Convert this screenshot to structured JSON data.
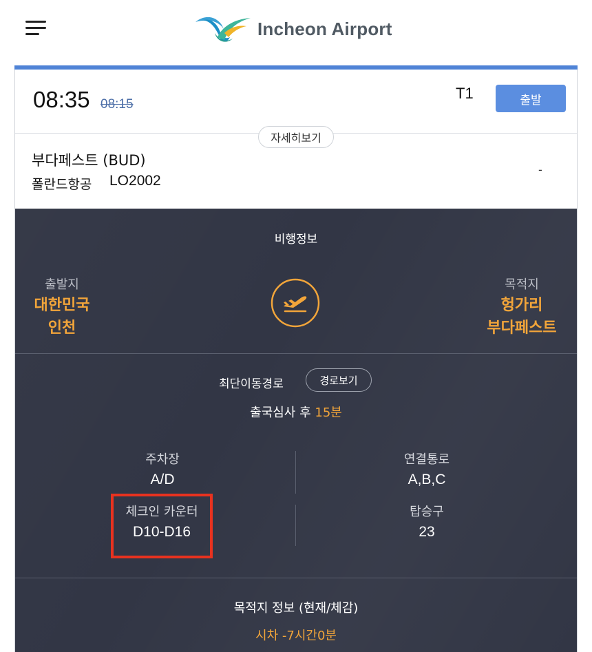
{
  "header": {
    "menu_icon": "hamburger-menu-icon",
    "logo_text": "Incheon Airport",
    "logo_icon": "incheon-airport-logo-icon"
  },
  "flight": {
    "time": "08:35",
    "scheduled_time": "08:15",
    "terminal": "T1",
    "status_label": "출발",
    "detail_button_label": "자세히보기",
    "destination": "부다페스트 (BUD)",
    "airline": "폴란드항공",
    "flight_number": "LO2002",
    "extra": "-"
  },
  "flight_info": {
    "section_title": "비행정보",
    "origin_label": "출발지",
    "origin_country": "대한민국",
    "origin_city": "인천",
    "destination_label": "목적지",
    "destination_country": "헝가리",
    "destination_city": "부다페스트",
    "plane_icon": "departure-plane-icon"
  },
  "route": {
    "title": "최단이동경로",
    "button_label": "경로보기",
    "info_prefix": "출국심사 후",
    "info_time": "15분"
  },
  "facilities": {
    "parking_label": "주차장",
    "parking_value": "A/D",
    "passage_label": "연결통로",
    "passage_value": "A,B,C",
    "checkin_label": "체크인 카운터",
    "checkin_value": "D10-D16",
    "gate_label": "탑승구",
    "gate_value": "23"
  },
  "destination_info": {
    "title": "목적지 정보 (현재/체감)",
    "time_diff_label": "시차",
    "time_diff_value": "-7시간0분"
  },
  "colors": {
    "accent_blue": "#4f83d6",
    "button_blue": "#5b8ee0",
    "orange": "#f2a53a",
    "dark_bg": "#323645",
    "highlight_red": "#e8321f"
  }
}
